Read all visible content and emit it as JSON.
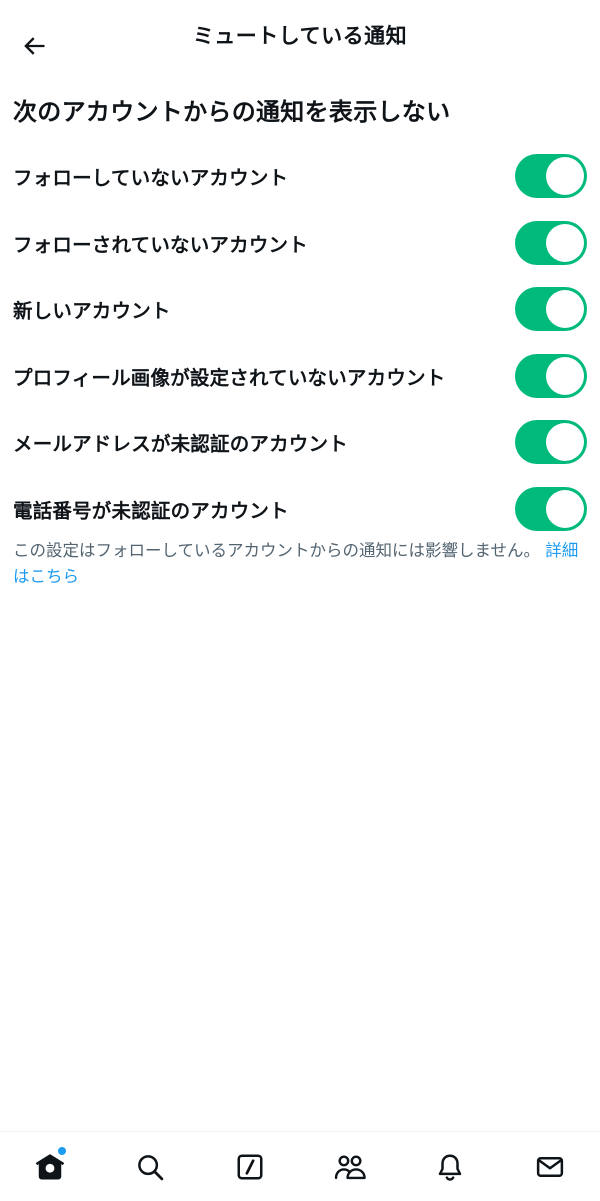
{
  "header": {
    "title": "ミュートしている通知",
    "back_icon": "arrow-left-icon"
  },
  "section": {
    "heading": "次のアカウントからの通知を表示しない"
  },
  "settings": [
    {
      "label": "フォローしていないアカウント",
      "enabled": true
    },
    {
      "label": "フォローされていないアカウント",
      "enabled": true
    },
    {
      "label": "新しいアカウント",
      "enabled": true
    },
    {
      "label": "プロフィール画像が設定されていないアカウント",
      "enabled": true
    },
    {
      "label": "メールアドレスが未認証のアカウント",
      "enabled": true
    },
    {
      "label": "電話番号が未認証のアカウント",
      "enabled": true
    }
  ],
  "note": {
    "text": "この設定はフォローしているアカウントからの通知には影響しません。",
    "link": "詳細はこちら"
  },
  "bottom_nav": {
    "items": [
      {
        "icon": "home-icon",
        "active": true,
        "has_badge": true
      },
      {
        "icon": "search-icon",
        "active": false
      },
      {
        "icon": "compose-icon",
        "active": false
      },
      {
        "icon": "communities-icon",
        "active": false
      },
      {
        "icon": "bell-icon",
        "active": false
      },
      {
        "icon": "mail-icon",
        "active": false
      }
    ]
  },
  "colors": {
    "toggle_on": "#00ba7c",
    "link": "#1d9bf0",
    "text": "#0f1419",
    "muted_text": "#536471",
    "badge": "#1d9bf0"
  }
}
